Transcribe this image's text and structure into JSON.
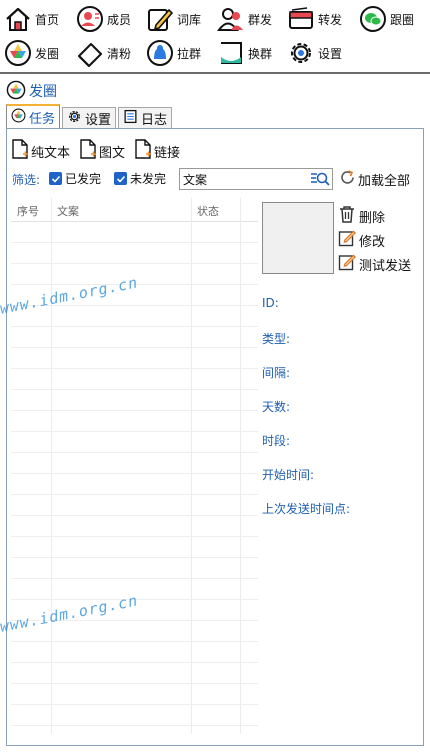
{
  "toolbar": {
    "row1": [
      {
        "label": "首页",
        "icon": "home-icon"
      },
      {
        "label": "成员",
        "icon": "member-icon"
      },
      {
        "label": "词库",
        "icon": "pencil-icon"
      },
      {
        "label": "群发",
        "icon": "group-send-icon"
      },
      {
        "label": "转发",
        "icon": "forward-icon"
      },
      {
        "label": "跟圈",
        "icon": "follow-circle-icon"
      }
    ],
    "row2": [
      {
        "label": "发圈",
        "icon": "moments-icon"
      },
      {
        "label": "清粉",
        "icon": "eraser-icon"
      },
      {
        "label": "拉群",
        "icon": "pull-group-icon"
      },
      {
        "label": "换群",
        "icon": "switch-group-icon"
      },
      {
        "label": "设置",
        "icon": "gear-icon"
      }
    ]
  },
  "section": {
    "title": "发圈"
  },
  "tabs": [
    {
      "label": "任务",
      "icon": "camera-aperture-icon",
      "active": true
    },
    {
      "label": "设置",
      "icon": "gear-icon",
      "active": false
    },
    {
      "label": "日志",
      "icon": "log-icon",
      "active": false
    }
  ],
  "add_buttons": [
    "纯文本",
    "图文",
    "链接"
  ],
  "filter": {
    "label": "筛选:",
    "sent_label": "已发完",
    "unsent_label": "未发完",
    "sent_checked": true,
    "unsent_checked": true,
    "search_value": "文案",
    "load_all": "加载全部"
  },
  "table": {
    "headers": [
      "序号",
      "文案",
      "状态"
    ]
  },
  "actions": {
    "delete": "删除",
    "edit": "修改",
    "test_send": "测试发送"
  },
  "details": {
    "id": "ID:",
    "type": "类型:",
    "interval": "间隔:",
    "days": "天数:",
    "period": "时段:",
    "start_time": "开始时间:",
    "last_sent": "上次发送时间点:"
  },
  "watermark": "www.idm.org.cn",
  "colors": {
    "accent": "#1f5fb0",
    "checkbox": "#1f63c6",
    "tab_active_border": "#f2b233"
  }
}
